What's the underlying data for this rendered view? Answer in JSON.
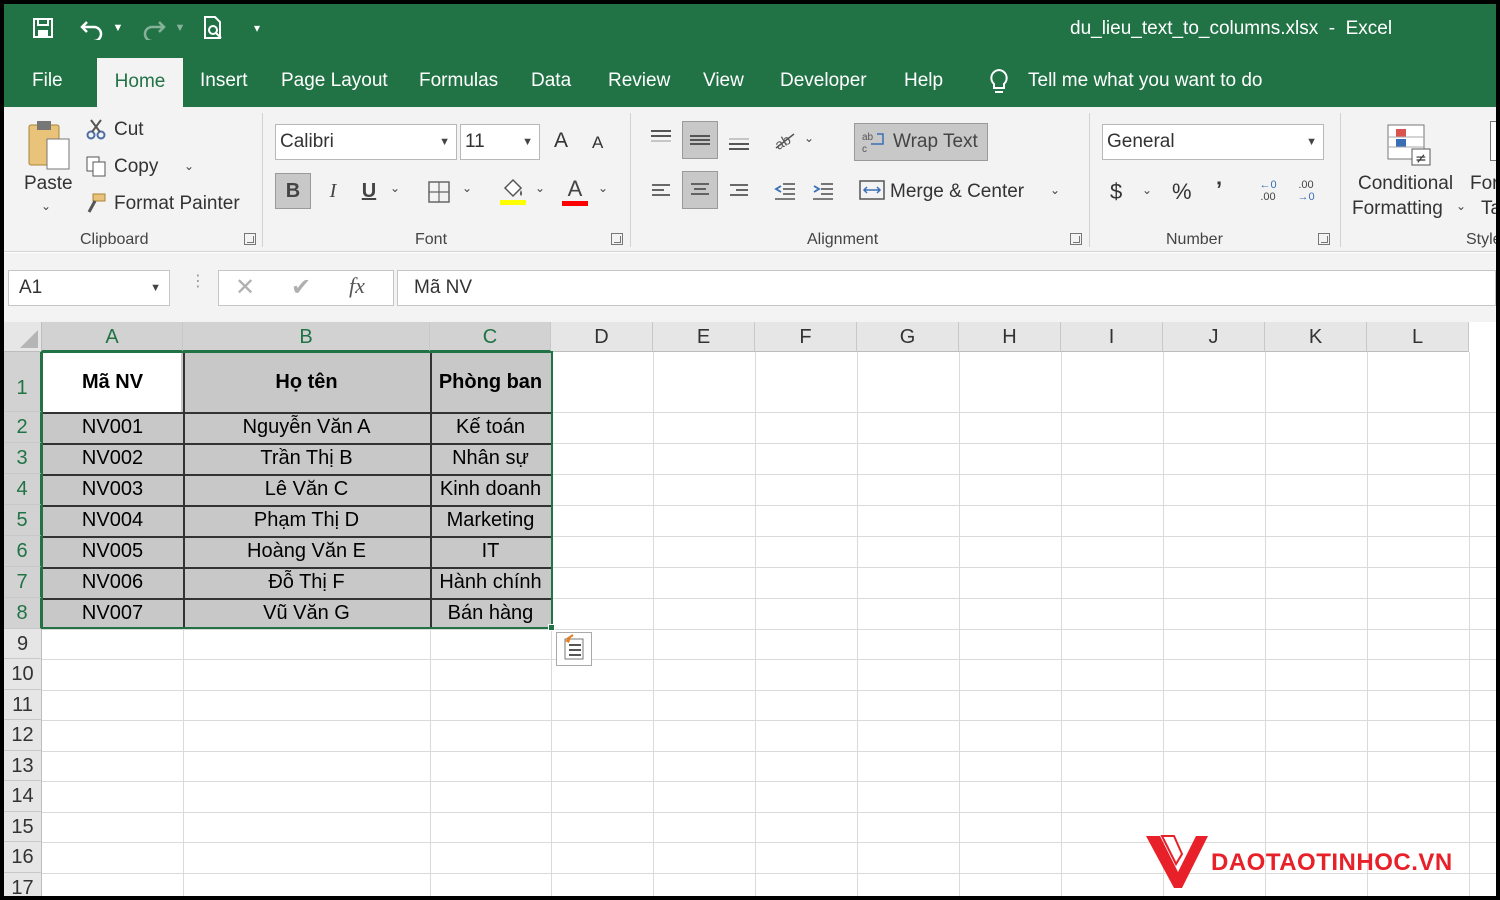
{
  "window": {
    "title": "du_lieu_text_to_columns.xlsx  -  Excel"
  },
  "tabs": [
    {
      "label": "File"
    },
    {
      "label": "Home"
    },
    {
      "label": "Insert"
    },
    {
      "label": "Page Layout"
    },
    {
      "label": "Formulas"
    },
    {
      "label": "Data"
    },
    {
      "label": "Review"
    },
    {
      "label": "View"
    },
    {
      "label": "Developer"
    },
    {
      "label": "Help"
    }
  ],
  "tell_me": "Tell me what you want to do",
  "clipboard": {
    "paste": "Paste",
    "cut": "Cut",
    "copy": "Copy",
    "format_painter": "Format Painter",
    "group": "Clipboard"
  },
  "font": {
    "name": "Calibri",
    "size": "11",
    "group": "Font",
    "bold": "B",
    "italic": "I",
    "underline": "U",
    "grow": "A",
    "shrink": "A",
    "color_letter": "A",
    "highlight_color": "#ffff00",
    "font_color": "#ff0000"
  },
  "alignment": {
    "wrap": "Wrap Text",
    "merge": "Merge & Center",
    "group": "Alignment"
  },
  "number": {
    "format": "General",
    "currency": "$",
    "percent": "%",
    "comma": "’",
    "inc": ".00",
    "dec": ".00",
    "group": "Number"
  },
  "styles": {
    "conditional_1": "Conditional",
    "conditional_2": "Formatting",
    "format_table_1": "For",
    "format_table_2": "Ta",
    "group": "Style"
  },
  "formula_bar": {
    "name_box": "A1",
    "fx": "fx",
    "content": "Mã NV"
  },
  "columns": [
    "A",
    "B",
    "C",
    "D",
    "E",
    "F",
    "G",
    "H",
    "I",
    "J",
    "K",
    "L"
  ],
  "rows": [
    "1",
    "2",
    "3",
    "4",
    "5",
    "6",
    "7",
    "8",
    "9",
    "10",
    "11",
    "12",
    "13",
    "14",
    "15",
    "16",
    "17"
  ],
  "table": {
    "headers": [
      "Mã NV",
      "Họ tên",
      "Phòng ban"
    ],
    "rows": [
      [
        "NV001",
        "Nguyễn Văn A",
        "Kế toán"
      ],
      [
        "NV002",
        "Trần Thị B",
        "Nhân sự"
      ],
      [
        "NV003",
        "Lê Văn C",
        "Kinh doanh"
      ],
      [
        "NV004",
        "Phạm Thị D",
        "Marketing"
      ],
      [
        "NV005",
        "Hoàng Văn E",
        "IT"
      ],
      [
        "NV006",
        "Đỗ Thị F",
        "Hành chính"
      ],
      [
        "NV007",
        "Vũ Văn G",
        "Bán hàng"
      ]
    ]
  },
  "colors": {
    "accent": "#217346",
    "data_fill": "#c8c8c8",
    "watermark": "#e8202a"
  },
  "watermark": {
    "text": "DAOTAOTINHOC.VN"
  }
}
